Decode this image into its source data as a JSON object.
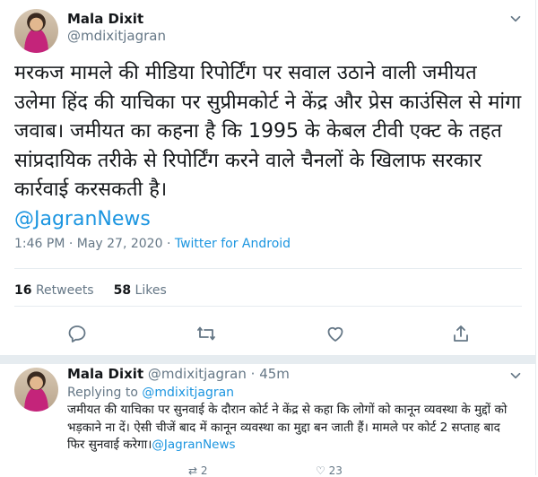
{
  "main_tweet": {
    "name": "Mala Dixit",
    "handle": "@mdixitjagran",
    "text": "मरकज मामले की मीडिया रिपोर्टिंग पर सवाल उठाने वाली जमीयत उलेमा हिंद की याचिका पर सुप्रीमकोर्ट ने केंद्र और प्रेस काउंसिल से मांगा जवाब। जमीयत का कहना है कि 1995 के केबल टीवी एक्ट के तहत सांप्रदायिक तरीके से रिपोर्टिंग करने वाले चैनलों के खिलाफ सरकार कार्रवाई करसकती है।",
    "mention": "@JagranNews",
    "timestamp": "1:46 PM · May 27, 2020 · ",
    "source": "Twitter for Android",
    "retweets_count": "16",
    "retweets_label": "Retweets",
    "likes_count": "58",
    "likes_label": "Likes"
  },
  "reply_tweet": {
    "name": "Mala Dixit",
    "handle": "@mdixitjagran",
    "time": " · 45m",
    "replying_prefix": "Replying to ",
    "replying_to": "@mdixitjagran",
    "text": "जमीयत की याचिका पर सुनवाई के दौरान कोर्ट ने केंद्र से कहा कि लोगों को कानून व्यवस्था के मुद्दों को भड़काने ना दें। ऐसी चीजें बाद में कानून व्यवस्था का मुद्दा बन जाती हैं। मामले पर कोर्ट 2 सप्ताह बाद फिर सुनवाई करेगा।",
    "mention": "@JagranNews",
    "retweets_count": "2",
    "likes_count": "23"
  },
  "icons": [
    "chevron-down-icon",
    "reply-icon",
    "retweet-icon",
    "like-icon",
    "share-icon"
  ],
  "colors": {
    "accent": "#1b95e0",
    "secondary_text": "#657786",
    "border": "#e6ecf0"
  }
}
